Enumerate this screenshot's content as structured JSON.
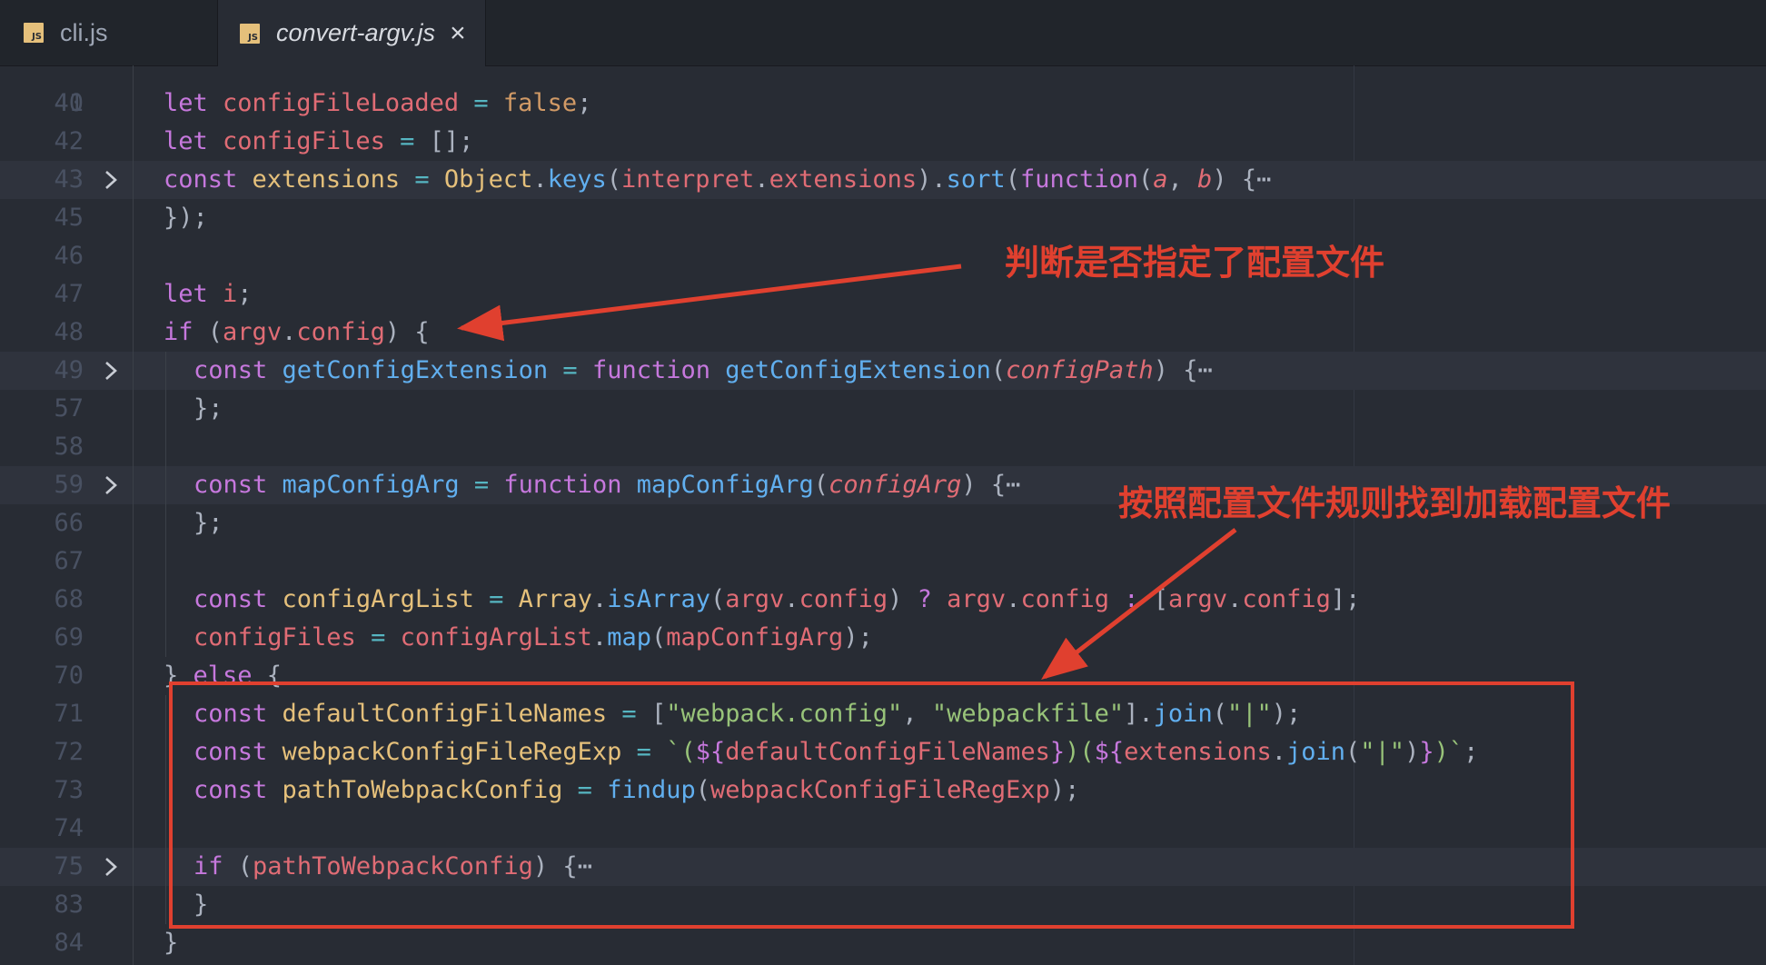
{
  "tabs": [
    {
      "label": "cli.js",
      "icon": "js-file-icon",
      "active": false
    },
    {
      "label": "convert-argv.js",
      "icon": "js-file-icon",
      "active": true
    }
  ],
  "editor": {
    "top_partial_line_number": "40",
    "lines": [
      {
        "n": "41",
        "indent": 0,
        "folded": false,
        "tokens": [
          [
            "kw",
            "let "
          ],
          [
            "var",
            "configFileLoaded"
          ],
          [
            "op",
            " = "
          ],
          [
            "cst",
            "false"
          ],
          [
            "pun",
            ";"
          ]
        ]
      },
      {
        "n": "42",
        "indent": 0,
        "folded": false,
        "tokens": [
          [
            "kw",
            "let "
          ],
          [
            "var",
            "configFiles"
          ],
          [
            "op",
            " = "
          ],
          [
            "pun",
            "[];"
          ]
        ]
      },
      {
        "n": "43",
        "indent": 0,
        "folded": true,
        "tokens": [
          [
            "kw",
            "const "
          ],
          [
            "cls",
            "extensions"
          ],
          [
            "op",
            " = "
          ],
          [
            "cls",
            "Object"
          ],
          [
            "pun",
            "."
          ],
          [
            "fn",
            "keys"
          ],
          [
            "pun",
            "("
          ],
          [
            "var",
            "interpret"
          ],
          [
            "pun",
            "."
          ],
          [
            "var",
            "extensions"
          ],
          [
            "pun",
            ")."
          ],
          [
            "fn",
            "sort"
          ],
          [
            "pun",
            "("
          ],
          [
            "kw",
            "function"
          ],
          [
            "pun",
            "("
          ],
          [
            "prm",
            "a"
          ],
          [
            "pun",
            ", "
          ],
          [
            "prm",
            "b"
          ],
          [
            "pun",
            ") {"
          ],
          [
            "ell",
            "⋯"
          ]
        ]
      },
      {
        "n": "45",
        "indent": 0,
        "folded": false,
        "tokens": [
          [
            "pun",
            "});"
          ]
        ]
      },
      {
        "n": "46",
        "indent": 0,
        "folded": false,
        "tokens": []
      },
      {
        "n": "47",
        "indent": 0,
        "folded": false,
        "tokens": [
          [
            "kw",
            "let "
          ],
          [
            "var",
            "i"
          ],
          [
            "pun",
            ";"
          ]
        ]
      },
      {
        "n": "48",
        "indent": 0,
        "folded": false,
        "tokens": [
          [
            "kw",
            "if "
          ],
          [
            "pun",
            "("
          ],
          [
            "var",
            "argv"
          ],
          [
            "pun",
            "."
          ],
          [
            "var",
            "config"
          ],
          [
            "pun",
            ") {"
          ]
        ]
      },
      {
        "n": "49",
        "indent": 1,
        "folded": true,
        "tokens": [
          [
            "kw",
            "const "
          ],
          [
            "fn",
            "getConfigExtension"
          ],
          [
            "op",
            " = "
          ],
          [
            "kw",
            "function "
          ],
          [
            "fn",
            "getConfigExtension"
          ],
          [
            "pun",
            "("
          ],
          [
            "prm",
            "configPath"
          ],
          [
            "pun",
            ") {"
          ],
          [
            "ell",
            "⋯"
          ]
        ]
      },
      {
        "n": "57",
        "indent": 1,
        "folded": false,
        "tokens": [
          [
            "pun",
            "};"
          ]
        ]
      },
      {
        "n": "58",
        "indent": 1,
        "folded": false,
        "tokens": []
      },
      {
        "n": "59",
        "indent": 1,
        "folded": true,
        "tokens": [
          [
            "kw",
            "const "
          ],
          [
            "fn",
            "mapConfigArg"
          ],
          [
            "op",
            " = "
          ],
          [
            "kw",
            "function "
          ],
          [
            "fn",
            "mapConfigArg"
          ],
          [
            "pun",
            "("
          ],
          [
            "prm",
            "configArg"
          ],
          [
            "pun",
            ") {"
          ],
          [
            "ell",
            "⋯"
          ]
        ]
      },
      {
        "n": "66",
        "indent": 1,
        "folded": false,
        "tokens": [
          [
            "pun",
            "};"
          ]
        ]
      },
      {
        "n": "67",
        "indent": 1,
        "folded": false,
        "tokens": []
      },
      {
        "n": "68",
        "indent": 1,
        "folded": false,
        "tokens": [
          [
            "kw",
            "const "
          ],
          [
            "cls",
            "configArgList"
          ],
          [
            "op",
            " = "
          ],
          [
            "cls",
            "Array"
          ],
          [
            "pun",
            "."
          ],
          [
            "fn",
            "isArray"
          ],
          [
            "pun",
            "("
          ],
          [
            "var",
            "argv"
          ],
          [
            "pun",
            "."
          ],
          [
            "var",
            "config"
          ],
          [
            "pun",
            ") "
          ],
          [
            "kw",
            "?"
          ],
          [
            "pun",
            " "
          ],
          [
            "var",
            "argv"
          ],
          [
            "pun",
            "."
          ],
          [
            "var",
            "config"
          ],
          [
            "pun",
            " "
          ],
          [
            "kw",
            ":"
          ],
          [
            "pun",
            " ["
          ],
          [
            "var",
            "argv"
          ],
          [
            "pun",
            "."
          ],
          [
            "var",
            "config"
          ],
          [
            "pun",
            "];"
          ]
        ]
      },
      {
        "n": "69",
        "indent": 1,
        "folded": false,
        "tokens": [
          [
            "var",
            "configFiles"
          ],
          [
            "op",
            " = "
          ],
          [
            "var",
            "configArgList"
          ],
          [
            "pun",
            "."
          ],
          [
            "fn",
            "map"
          ],
          [
            "pun",
            "("
          ],
          [
            "var",
            "mapConfigArg"
          ],
          [
            "pun",
            ");"
          ]
        ]
      },
      {
        "n": "70",
        "indent": 0,
        "folded": false,
        "tokens": [
          [
            "pun",
            "} "
          ],
          [
            "kw",
            "else"
          ],
          [
            "pun",
            " {"
          ]
        ]
      },
      {
        "n": "71",
        "indent": 1,
        "folded": false,
        "tokens": [
          [
            "kw",
            "const "
          ],
          [
            "cls",
            "defaultConfigFileNames"
          ],
          [
            "op",
            " = "
          ],
          [
            "pun",
            "["
          ],
          [
            "str",
            "\"webpack.config\""
          ],
          [
            "pun",
            ", "
          ],
          [
            "str",
            "\"webpackfile\""
          ],
          [
            "pun",
            "]."
          ],
          [
            "fn",
            "join"
          ],
          [
            "pun",
            "("
          ],
          [
            "str",
            "\"|\""
          ],
          [
            "pun",
            ");"
          ]
        ]
      },
      {
        "n": "72",
        "indent": 1,
        "folded": false,
        "tokens": [
          [
            "kw",
            "const "
          ],
          [
            "cls",
            "webpackConfigFileRegExp"
          ],
          [
            "op",
            " = "
          ],
          [
            "str",
            "`("
          ],
          [
            "kw",
            "${"
          ],
          [
            "var",
            "defaultConfigFileNames"
          ],
          [
            "kw",
            "}"
          ],
          [
            "str",
            ")("
          ],
          [
            "kw",
            "${"
          ],
          [
            "var",
            "extensions"
          ],
          [
            "pun",
            "."
          ],
          [
            "fn",
            "join"
          ],
          [
            "pun",
            "("
          ],
          [
            "str",
            "\"|\""
          ],
          [
            "pun",
            ")"
          ],
          [
            "kw",
            "}"
          ],
          [
            "str",
            ")`"
          ],
          [
            "pun",
            ";"
          ]
        ]
      },
      {
        "n": "73",
        "indent": 1,
        "folded": false,
        "tokens": [
          [
            "kw",
            "const "
          ],
          [
            "cls",
            "pathToWebpackConfig"
          ],
          [
            "op",
            " = "
          ],
          [
            "fn",
            "findup"
          ],
          [
            "pun",
            "("
          ],
          [
            "var",
            "webpackConfigFileRegExp"
          ],
          [
            "pun",
            ");"
          ]
        ]
      },
      {
        "n": "74",
        "indent": 1,
        "folded": false,
        "tokens": []
      },
      {
        "n": "75",
        "indent": 1,
        "folded": true,
        "tokens": [
          [
            "kw",
            "if "
          ],
          [
            "pun",
            "("
          ],
          [
            "var",
            "pathToWebpackConfig"
          ],
          [
            "pun",
            ") {"
          ],
          [
            "ell",
            "⋯"
          ]
        ]
      },
      {
        "n": "83",
        "indent": 1,
        "folded": false,
        "tokens": [
          [
            "pun",
            "}"
          ]
        ]
      },
      {
        "n": "84",
        "indent": 0,
        "folded": false,
        "tokens": [
          [
            "pun",
            "}"
          ]
        ]
      }
    ]
  },
  "annotations": {
    "top": "判断是否指定了配置文件",
    "bottom": "按照配置文件规则找到加载配置文件",
    "color": "#e0402f"
  },
  "theme": {
    "background": "#282c34",
    "tabbar": "#21252b",
    "keyword": "#c678dd",
    "variable": "#e06c75",
    "function": "#61afef",
    "class": "#e5c07b",
    "string": "#98c379",
    "operator": "#56b6c2",
    "constant": "#d19a66"
  }
}
